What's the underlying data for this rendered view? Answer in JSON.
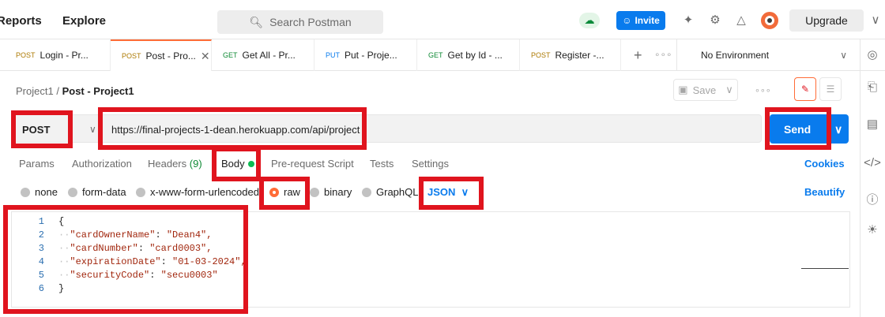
{
  "topbar": {
    "nav": [
      "Reports",
      "Explore"
    ],
    "search_placeholder": "Search Postman",
    "invite_label": "Invite",
    "upgrade_label": "Upgrade"
  },
  "tabs": [
    {
      "method": "POST",
      "label": "Login - Pr..."
    },
    {
      "method": "POST",
      "label": "Post - Pro..."
    },
    {
      "method": "GET",
      "label": "Get All - Pr..."
    },
    {
      "method": "PUT",
      "label": "Put - Proje..."
    },
    {
      "method": "GET",
      "label": "Get by Id - ..."
    },
    {
      "method": "POST",
      "label": "Register -..."
    }
  ],
  "environment": "No Environment",
  "breadcrumb": {
    "parent": "Project1",
    "separator": "/",
    "current": "Post - Project1"
  },
  "save_label": "Save",
  "request": {
    "method": "POST",
    "url": "https://final-projects-1-dean.herokuapp.com/api/project",
    "send_label": "Send"
  },
  "request_tabs": {
    "params": "Params",
    "authorization": "Authorization",
    "headers": "Headers",
    "headers_count": "(9)",
    "body": "Body",
    "prerequest": "Pre-request Script",
    "tests": "Tests",
    "settings": "Settings",
    "cookies": "Cookies"
  },
  "body_types": {
    "none": "none",
    "form_data": "form-data",
    "urlencoded": "x-www-form-urlencoded",
    "raw": "raw",
    "binary": "binary",
    "graphql": "GraphQL",
    "format": "JSON",
    "beautify": "Beautify"
  },
  "editor": {
    "line_numbers": [
      "1",
      "2",
      "3",
      "4",
      "5",
      "6"
    ],
    "open_brace": "{",
    "close_brace": "}",
    "lines": [
      {
        "key": "\"cardOwnerName\"",
        "value": "\"Dean4\","
      },
      {
        "key": "\"cardNumber\"",
        "value": "\"card0003\","
      },
      {
        "key": "\"expirationDate\"",
        "value": "\"01-03-2024\","
      },
      {
        "key": "\"securityCode\"",
        "value": "\"secu0003\""
      }
    ]
  },
  "colors": {
    "accent": "#097bed",
    "brand": "#ff6c37",
    "highlight": "#e0141e"
  }
}
